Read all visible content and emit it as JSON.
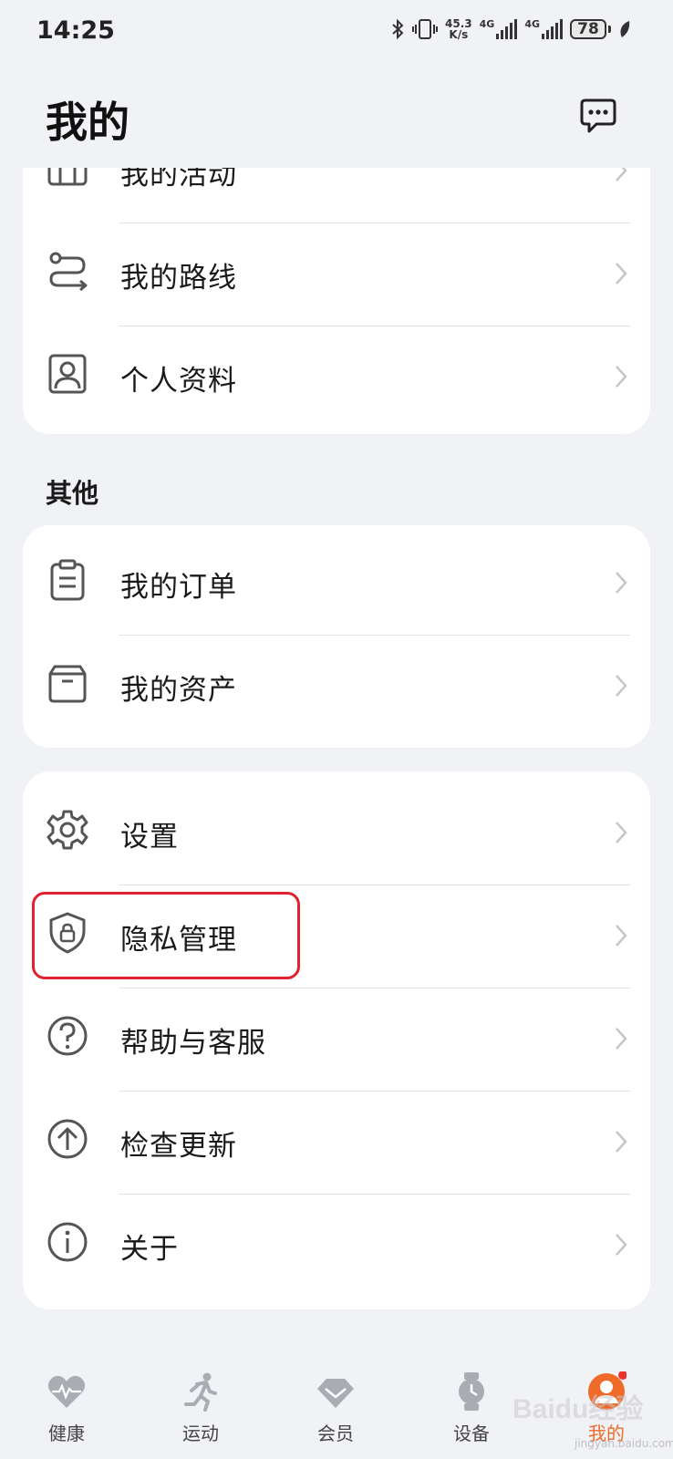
{
  "status": {
    "time": "14:25",
    "speed_top": "45.3",
    "speed_bottom": "K/s",
    "net1": "4G",
    "net2": "4G",
    "battery": "78"
  },
  "header": {
    "title": "我的",
    "message_icon": "chat-bubble-icon"
  },
  "card1": {
    "items": [
      {
        "label": "我的活动",
        "icon": "calendar-icon"
      },
      {
        "label": "我的路线",
        "icon": "route-icon"
      },
      {
        "label": "个人资料",
        "icon": "profile-icon"
      }
    ]
  },
  "section_other": {
    "title": "其他"
  },
  "card2": {
    "items": [
      {
        "label": "我的订单",
        "icon": "clipboard-icon"
      },
      {
        "label": "我的资产",
        "icon": "box-icon"
      }
    ]
  },
  "card3": {
    "items": [
      {
        "label": "设置",
        "icon": "gear-icon"
      },
      {
        "label": "隐私管理",
        "icon": "shield-lock-icon"
      },
      {
        "label": "帮助与客服",
        "icon": "help-icon"
      },
      {
        "label": "检查更新",
        "icon": "upload-arrow-icon"
      },
      {
        "label": "关于",
        "icon": "info-icon"
      }
    ]
  },
  "tabbar": {
    "tabs": [
      {
        "label": "健康",
        "icon": "heart-icon"
      },
      {
        "label": "运动",
        "icon": "runner-icon"
      },
      {
        "label": "会员",
        "icon": "diamond-icon"
      },
      {
        "label": "设备",
        "icon": "watch-icon"
      },
      {
        "label": "我的",
        "icon": "avatar-icon"
      }
    ],
    "active": "我的"
  },
  "watermark": {
    "text": "Baidu经验",
    "sub": "jingyan.baidu.com"
  },
  "colors": {
    "accent": "#f06a2a",
    "highlight": "#e0212f",
    "background": "#f1f2f5"
  }
}
